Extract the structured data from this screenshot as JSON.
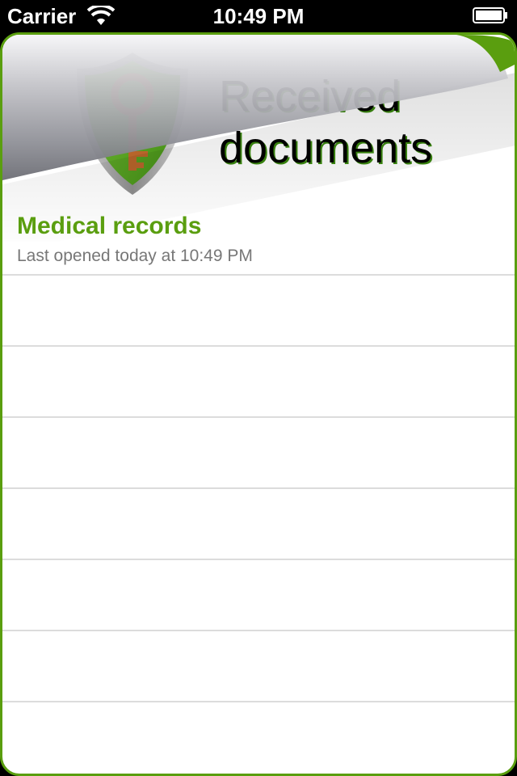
{
  "status_bar": {
    "carrier": "Carrier",
    "time": "10:49 PM",
    "wifi_icon": "wifi-icon",
    "battery_icon": "battery-icon"
  },
  "header": {
    "title_line1": "Received",
    "title_line2": "documents",
    "logo_icon": "shield-key-icon",
    "accent_color": "#5a9e0f"
  },
  "documents": [
    {
      "title": "Medical records",
      "subtitle": "Last opened today at 10:49 PM"
    }
  ]
}
